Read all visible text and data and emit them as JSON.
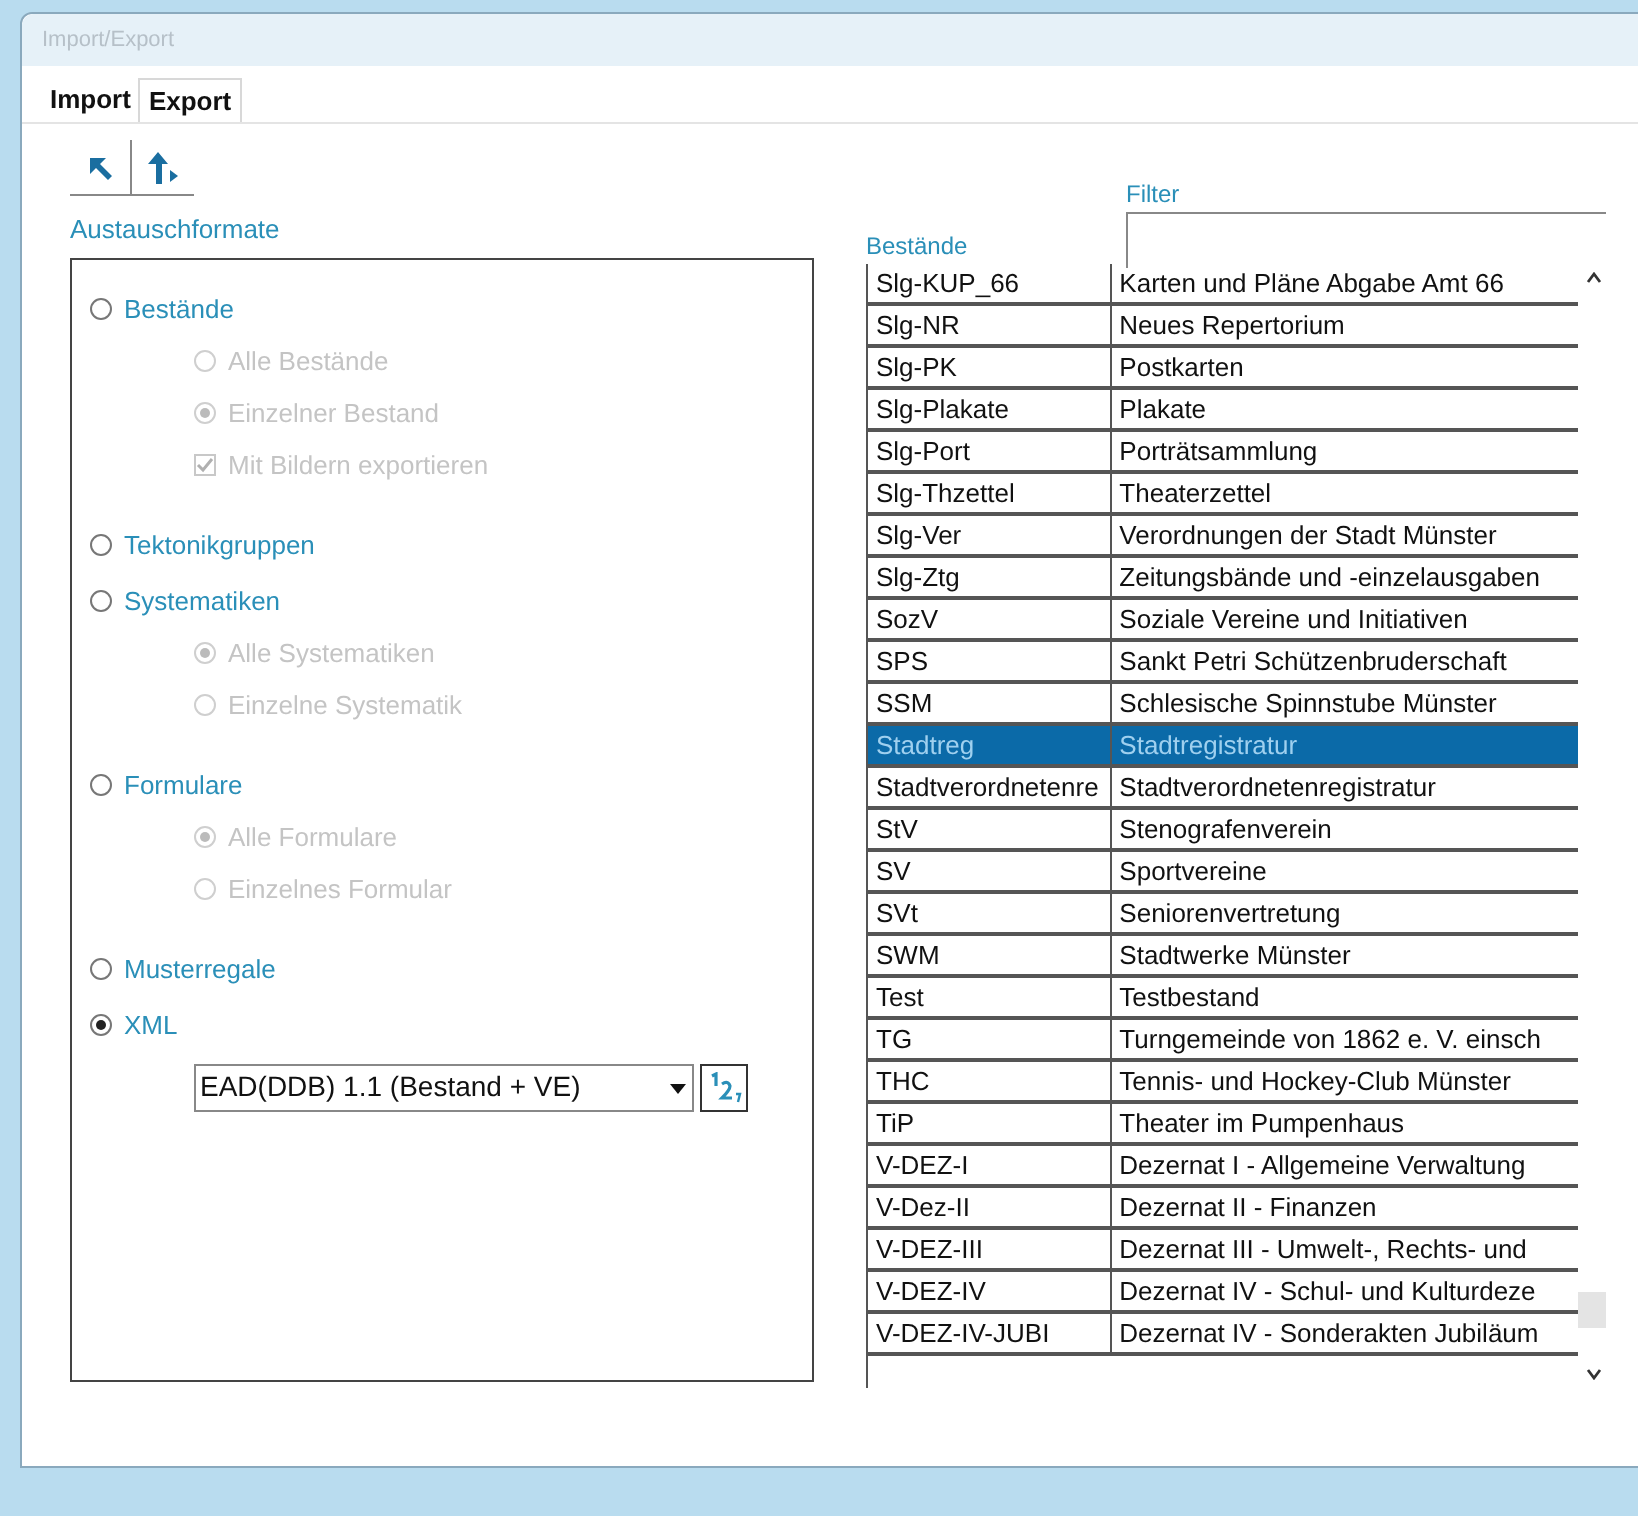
{
  "window": {
    "title": "Import/Export"
  },
  "tabs": [
    {
      "label": "Import",
      "selected": false
    },
    {
      "label": "Export",
      "selected": true
    }
  ],
  "formats": {
    "label": "Austauschformate",
    "options": [
      {
        "kind": "radio",
        "label": "Bestände",
        "selected": false,
        "disabled": false,
        "children": [
          {
            "kind": "radio",
            "label": "Alle Bestände",
            "selected": false,
            "disabled": true
          },
          {
            "kind": "radio",
            "label": "Einzelner Bestand",
            "selected": true,
            "disabled": true
          },
          {
            "kind": "checkbox",
            "label": "Mit Bildern exportieren",
            "checked": true,
            "disabled": true
          }
        ]
      },
      {
        "kind": "radio",
        "label": "Tektonikgruppen",
        "selected": false,
        "disabled": false
      },
      {
        "kind": "radio",
        "label": "Systematiken",
        "selected": false,
        "disabled": false,
        "children": [
          {
            "kind": "radio",
            "label": "Alle Systematiken",
            "selected": true,
            "disabled": true
          },
          {
            "kind": "radio",
            "label": "Einzelne Systematik",
            "selected": false,
            "disabled": true
          }
        ]
      },
      {
        "kind": "radio",
        "label": "Formulare",
        "selected": false,
        "disabled": false,
        "children": [
          {
            "kind": "radio",
            "label": "Alle Formulare",
            "selected": true,
            "disabled": true
          },
          {
            "kind": "radio",
            "label": "Einzelnes Formular",
            "selected": false,
            "disabled": true
          }
        ]
      },
      {
        "kind": "radio",
        "label": "Musterregale",
        "selected": false,
        "disabled": false
      },
      {
        "kind": "radio",
        "label": "XML",
        "selected": true,
        "disabled": false
      }
    ],
    "xml_format": {
      "value": "EAD(DDB) 1.1 (Bestand + VE)"
    }
  },
  "filter": {
    "label": "Filter"
  },
  "bestaende": {
    "label": "Bestände",
    "rows": [
      {
        "code": "Slg-KUP_66",
        "name": "Karten und Pläne Abgabe Amt 66",
        "selected": false
      },
      {
        "code": "Slg-NR",
        "name": "Neues Repertorium",
        "selected": false
      },
      {
        "code": "Slg-PK",
        "name": "Postkarten",
        "selected": false
      },
      {
        "code": "Slg-Plakate",
        "name": "Plakate",
        "selected": false
      },
      {
        "code": "Slg-Port",
        "name": "Porträtsammlung",
        "selected": false
      },
      {
        "code": "Slg-Thzettel",
        "name": "Theaterzettel",
        "selected": false
      },
      {
        "code": "Slg-Ver",
        "name": "Verordnungen der Stadt Münster",
        "selected": false
      },
      {
        "code": "Slg-Ztg",
        "name": "Zeitungsbände und -einzelausgaben",
        "selected": false
      },
      {
        "code": "SozV",
        "name": "Soziale Vereine und Initiativen",
        "selected": false
      },
      {
        "code": "SPS",
        "name": "Sankt Petri Schützenbruderschaft",
        "selected": false
      },
      {
        "code": "SSM",
        "name": "Schlesische Spinnstube Münster",
        "selected": false
      },
      {
        "code": "Stadtreg",
        "name": "Stadtregistratur",
        "selected": true
      },
      {
        "code": "Stadtverordnetenre",
        "name": "Stadtverordnetenregistratur",
        "selected": false
      },
      {
        "code": "StV",
        "name": "Stenografenverein",
        "selected": false
      },
      {
        "code": "SV",
        "name": "Sportvereine",
        "selected": false
      },
      {
        "code": "SVt",
        "name": "Seniorenvertretung",
        "selected": false
      },
      {
        "code": "SWM",
        "name": "Stadtwerke Münster",
        "selected": false
      },
      {
        "code": "Test",
        "name": "Testbestand",
        "selected": false
      },
      {
        "code": "TG",
        "name": "Turngemeinde von 1862 e. V. einsch",
        "selected": false
      },
      {
        "code": "THC",
        "name": "Tennis- und Hockey-Club Münster",
        "selected": false
      },
      {
        "code": "TiP",
        "name": "Theater im Pumpenhaus",
        "selected": false
      },
      {
        "code": "V-DEZ-I",
        "name": "Dezernat  I - Allgemeine Verwaltung",
        "selected": false
      },
      {
        "code": "V-Dez-II",
        "name": "Dezernat II - Finanzen",
        "selected": false
      },
      {
        "code": "V-DEZ-III",
        "name": "Dezernat III - Umwelt-, Rechts- und",
        "selected": false
      },
      {
        "code": "V-DEZ-IV",
        "name": "Dezernat IV - Schul- und Kulturdeze",
        "selected": false
      },
      {
        "code": "V-DEZ-IV-JUBI",
        "name": "Dezernat IV - Sonderakten Jubiläum",
        "selected": false
      }
    ]
  }
}
